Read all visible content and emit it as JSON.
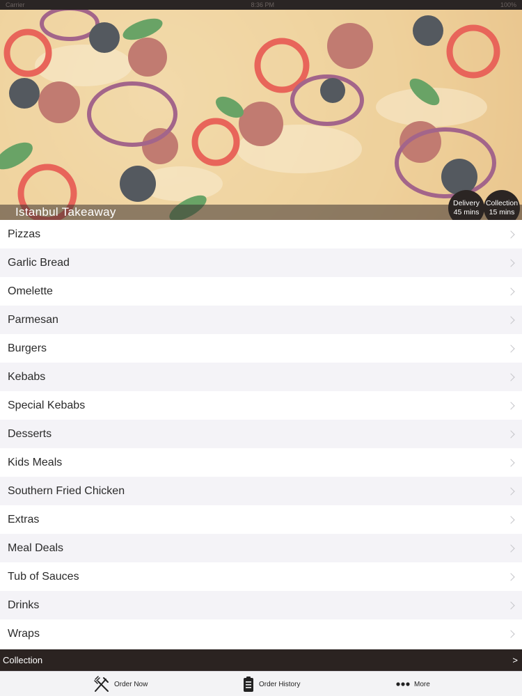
{
  "status_bar": {
    "carrier": "Carrier",
    "time": "8:36 PM",
    "battery": "100%"
  },
  "header": {
    "restaurant_name": "Istanbul Takeaway",
    "delivery": {
      "label": "Delivery",
      "time": "45 mins"
    },
    "collection": {
      "label": "Collection",
      "time": "15 mins"
    }
  },
  "menu": {
    "items": [
      {
        "label": "Pizzas"
      },
      {
        "label": "Garlic Bread"
      },
      {
        "label": "Omelette"
      },
      {
        "label": "Parmesan"
      },
      {
        "label": "Burgers"
      },
      {
        "label": "Kebabs"
      },
      {
        "label": "Special Kebabs"
      },
      {
        "label": "Desserts"
      },
      {
        "label": "Kids Meals"
      },
      {
        "label": "Southern Fried Chicken"
      },
      {
        "label": "Extras"
      },
      {
        "label": "Meal Deals"
      },
      {
        "label": "Tub of Sauces"
      },
      {
        "label": "Drinks"
      },
      {
        "label": "Wraps"
      }
    ]
  },
  "order_mode_bar": {
    "label": "Collection",
    "arrow": ">"
  },
  "tab_bar": {
    "tabs": [
      {
        "label": "Order Now",
        "icon": "fork-knife-icon"
      },
      {
        "label": "Order History",
        "icon": "clipboard-icon"
      },
      {
        "label": "More",
        "icon": "more-dots-icon"
      }
    ]
  },
  "colors": {
    "dark_bar": "#2b2321",
    "row_alt": "#f4f3f7",
    "chevron": "#c4c4c8"
  }
}
